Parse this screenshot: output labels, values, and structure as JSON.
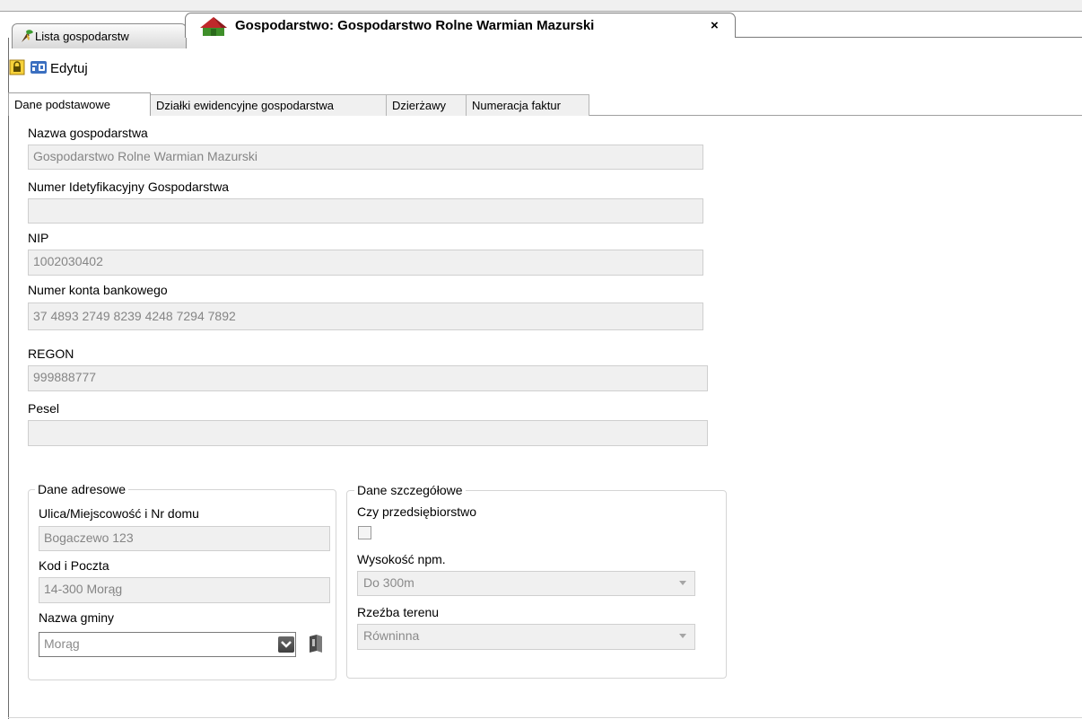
{
  "document_tabs": {
    "list_tab_label": "Lista gospodarstw",
    "active_tab_label": "Gospodarstwo: Gospodarstwo Rolne Warmian Mazurski",
    "close_glyph": "×"
  },
  "toolbar": {
    "lock_icon": "lock-icon",
    "edit_label": "Edytuj"
  },
  "inner_tabs": [
    {
      "label": "Dane podstawowe",
      "active": true
    },
    {
      "label": "Działki ewidencyjne gospodarstwa",
      "active": false
    },
    {
      "label": "Dzierżawy",
      "active": false
    },
    {
      "label": "Numeracja faktur",
      "active": false
    }
  ],
  "basic": {
    "farm_name_label": "Nazwa gospodarstwa",
    "farm_name_value": "Gospodarstwo Rolne Warmian Mazurski",
    "id_number_label": "Numer Idetyfikacyjny Gospodarstwa",
    "id_number_value": "",
    "nip_label": "NIP",
    "nip_value": "1002030402",
    "bank_label": "Numer konta bankowego",
    "bank_value": "37 4893 2749 8239 4248 7294 7892",
    "regon_label": "REGON",
    "regon_value": "999888777",
    "pesel_label": "Pesel",
    "pesel_value": ""
  },
  "address": {
    "legend": "Dane adresowe",
    "street_label": "Ulica/Miejscowość i Nr domu",
    "street_value": "Bogaczewo 123",
    "post_label": "Kod i Poczta",
    "post_value": "14-300 Morąg",
    "gmina_label": "Nazwa gminy",
    "gmina_value": "Morąg"
  },
  "details": {
    "legend": "Dane szczegółowe",
    "enterprise_label": "Czy przedsiębiorstwo",
    "enterprise_checked": false,
    "altitude_label": "Wysokość npm.",
    "altitude_value": "Do 300m",
    "terrain_label": "Rzeźba terenu",
    "terrain_value": "Równinna"
  },
  "colors": {
    "field_bg": "#f0f0f0",
    "field_text": "#858585",
    "tab_border": "#7a7a7a"
  }
}
